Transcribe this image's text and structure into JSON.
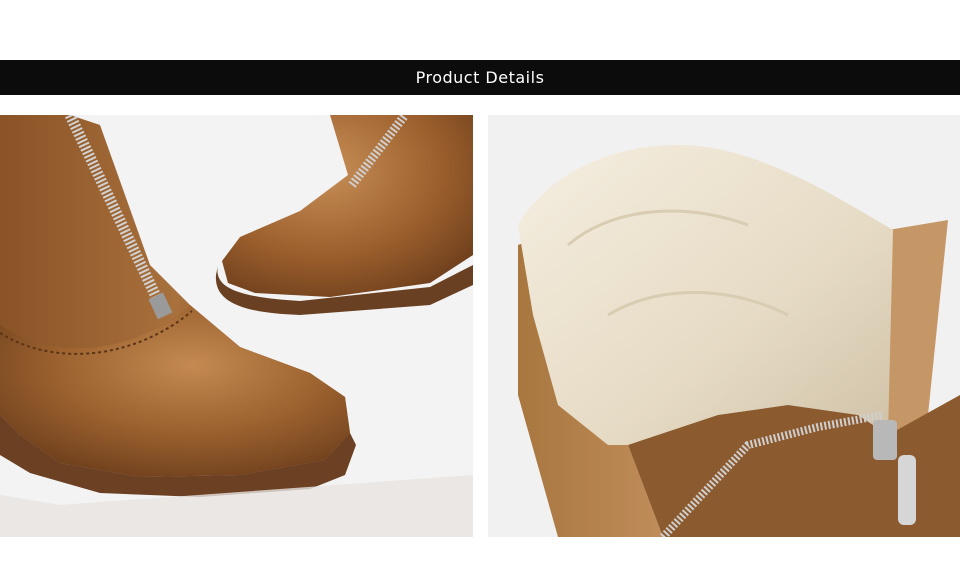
{
  "header": {
    "title": "Product Details"
  },
  "images": {
    "left": {
      "subject": "boot-toe-zipper-closeup-photo",
      "colors": {
        "leather": "#9a5f2b",
        "leather_light": "#c48a52",
        "sole": "#6b4023",
        "zipper": "#bfbfbf",
        "background": "#f3f3f3"
      }
    },
    "right": {
      "subject": "boot-cuff-lining-zipper-closeup-photo",
      "colors": {
        "lining": "#ece3cf",
        "suede": "#b98552",
        "zipper": "#c9c9c9",
        "background": "#f1f1f1"
      }
    }
  }
}
